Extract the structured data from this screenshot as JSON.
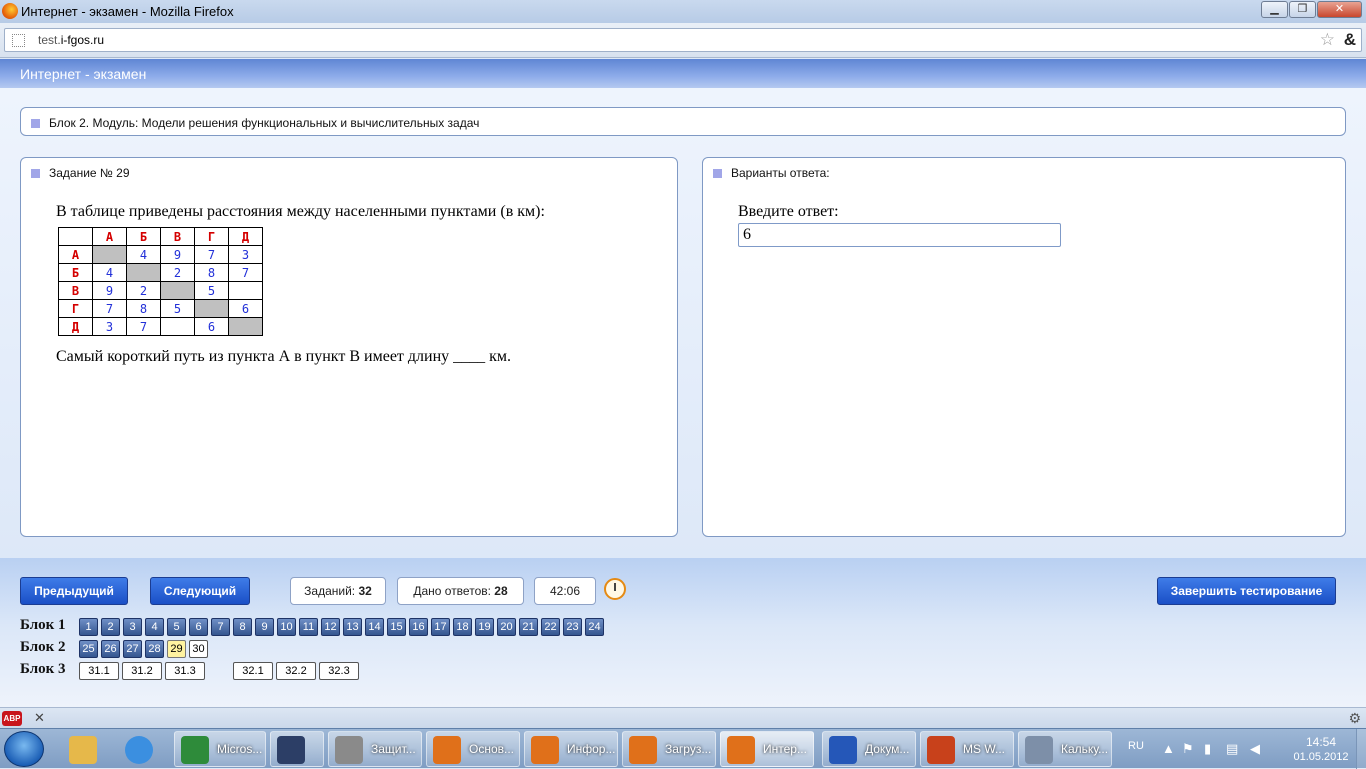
{
  "window": {
    "title": "Интернет - экзамен - Mozilla Firefox",
    "min": "▁",
    "max": "❐",
    "close": "✕"
  },
  "browser": {
    "url_prefix": "test.",
    "url_host": "i-fgos.ru",
    "bookmark": "☆",
    "addon": "&"
  },
  "app": {
    "header": "Интернет - экзамен"
  },
  "block": {
    "title": "Блок 2. Модуль: Модели решения функциональных и вычислительных задач"
  },
  "task": {
    "heading": "Задание № 29",
    "intro": "В таблице приведены расстояния между населенными пунктами (в км):",
    "col_headers": [
      "",
      "А",
      "Б",
      "В",
      "Г",
      "Д"
    ],
    "rows": [
      [
        "А",
        "",
        "4",
        "9",
        "7",
        "3"
      ],
      [
        "Б",
        "4",
        "",
        "2",
        "8",
        "7"
      ],
      [
        "В",
        "9",
        "2",
        "",
        "5",
        ""
      ],
      [
        "Г",
        "7",
        "8",
        "5",
        "",
        "6"
      ],
      [
        "Д",
        "3",
        "7",
        "",
        "6",
        ""
      ]
    ],
    "question": "Самый короткий путь из пункта А в пункт В имеет длину ____ км."
  },
  "answer": {
    "heading": "Варианты ответа:",
    "prompt": "Введите ответ:",
    "value": "6"
  },
  "nav": {
    "prev": "Предыдущий",
    "next": "Следующий",
    "tasks_label": "Заданий:",
    "tasks_count": "32",
    "answers_label": "Дано ответов:",
    "answers_count": "28",
    "timer": "42:06",
    "finish": "Завершить тестирование"
  },
  "blocks": [
    {
      "label": "Блок 1",
      "items": [
        "1",
        "2",
        "3",
        "4",
        "5",
        "6",
        "7",
        "8",
        "9",
        "10",
        "11",
        "12",
        "13",
        "14",
        "15",
        "16",
        "17",
        "18",
        "19",
        "20",
        "21",
        "22",
        "23",
        "24"
      ]
    },
    {
      "label": "Блок 2",
      "items": [
        "25",
        "26",
        "27",
        "28",
        "29",
        "30"
      ],
      "current": "29",
      "unanswered": [
        "30"
      ]
    },
    {
      "label": "Блок 3",
      "items": [
        "31.1",
        "31.2",
        "31.3",
        "32.1",
        "32.2",
        "32.3"
      ]
    }
  ],
  "addonbar": {
    "abp": "ABP",
    "close": "✕",
    "gear": "⚙"
  },
  "taskbar": {
    "items": [
      {
        "label": "Micros...",
        "color": "#2e8b3a"
      },
      {
        "label": "",
        "color": "#2c3e66"
      },
      {
        "label": "Защит...",
        "color": "#8a8a8a"
      },
      {
        "label": "Основ...",
        "color": "#e0701a"
      },
      {
        "label": "Инфор...",
        "color": "#e0701a"
      },
      {
        "label": "Загруз...",
        "color": "#e0701a"
      },
      {
        "label": "Интер...",
        "color": "#e0701a"
      },
      {
        "label": "Докум...",
        "color": "#2557b8"
      },
      {
        "label": "MS W...",
        "color": "#c8411b"
      },
      {
        "label": "Кальку...",
        "color": "#7d8fa8"
      }
    ],
    "lang": "RU",
    "time": "14:54",
    "date": "01.05.2012"
  }
}
